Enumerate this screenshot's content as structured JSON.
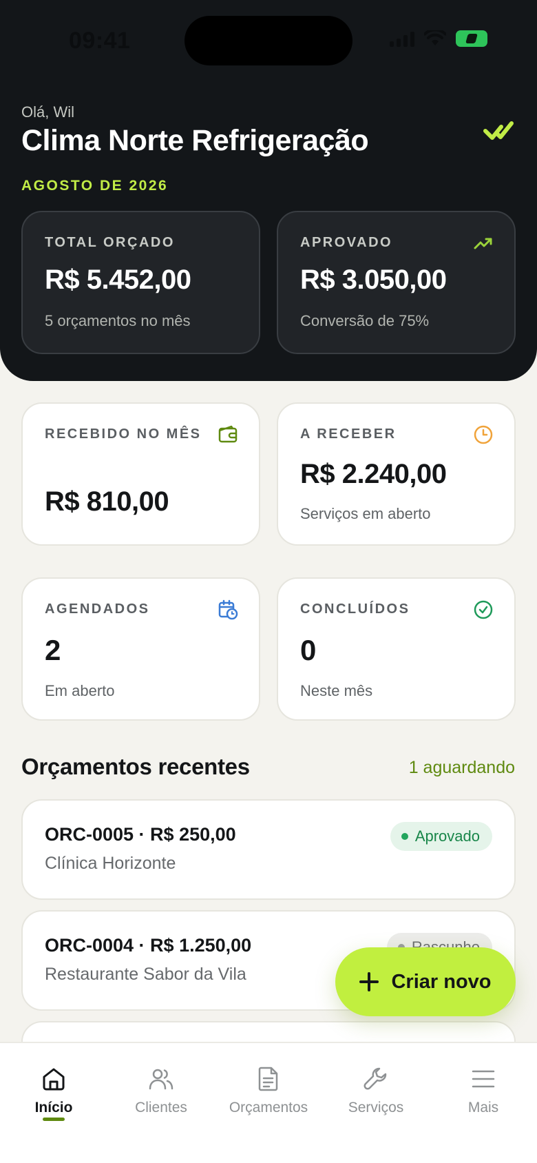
{
  "status_bar": {
    "time": "09:41"
  },
  "header": {
    "greeting": "Olá, Wil",
    "company": "Clima Norte Refrigeração",
    "period": "AGOSTO DE 2026",
    "icon": "check-double-icon"
  },
  "summary": {
    "total_orcado": {
      "label": "TOTAL ORÇADO",
      "value": "R$ 5.452,00",
      "sub": "5 orçamentos no mês"
    },
    "aprovado": {
      "label": "APROVADO",
      "value": "R$ 3.050,00",
      "sub": "Conversão de 75%",
      "icon": "trending-up-icon"
    }
  },
  "stats": {
    "recebido": {
      "label": "RECEBIDO NO MÊS",
      "value": "R$ 810,00",
      "icon": "wallet-icon"
    },
    "a_receber": {
      "label": "A RECEBER",
      "value": "R$ 2.240,00",
      "sub": "Serviços em aberto",
      "icon": "clock-icon"
    },
    "agendados": {
      "label": "AGENDADOS",
      "value": "2",
      "sub": "Em aberto",
      "icon": "calendar-clock-icon"
    },
    "concluidos": {
      "label": "CONCLUÍDOS",
      "value": "0",
      "sub": "Neste mês",
      "icon": "check-circle-icon"
    }
  },
  "recent": {
    "title": "Orçamentos recentes",
    "link": "1 aguardando",
    "items": [
      {
        "title": "ORC-0005 · R$ 250,00",
        "client": "Clínica Horizonte",
        "status": "Aprovado"
      },
      {
        "title": "ORC-0004 · R$ 1.250,00",
        "client": "Restaurante Sabor da Vila",
        "status": "Rascunho"
      }
    ]
  },
  "fab": {
    "label": "Criar novo"
  },
  "nav": {
    "items": [
      {
        "label": "Início",
        "icon": "home-icon"
      },
      {
        "label": "Clientes",
        "icon": "users-icon"
      },
      {
        "label": "Orçamentos",
        "icon": "document-icon"
      },
      {
        "label": "Serviços",
        "icon": "wrench-icon"
      },
      {
        "label": "Mais",
        "icon": "menu-icon"
      }
    ]
  },
  "colors": {
    "accent": "#c1ef3f",
    "dark": "#131619",
    "background": "#f4f3ee",
    "success": "#188649"
  }
}
